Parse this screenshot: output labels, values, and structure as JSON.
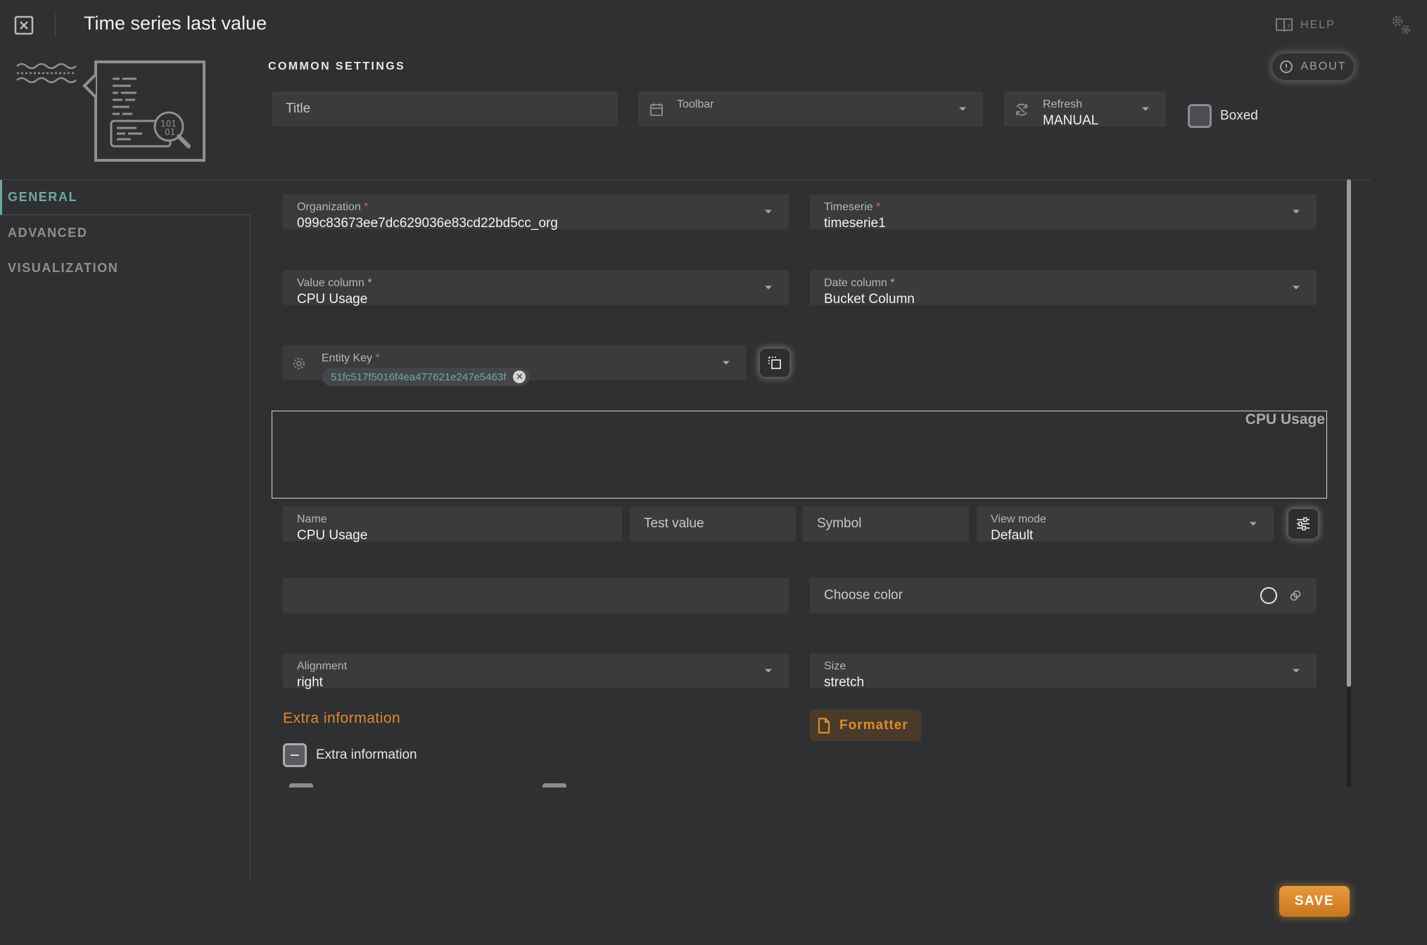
{
  "header": {
    "title": "Time series last value",
    "help_label": "HELP"
  },
  "common_settings": {
    "heading": "COMMON SETTINGS",
    "about_label": "ABOUT",
    "title_placeholder": "Title",
    "toolbar_label": "Toolbar",
    "toolbar_value": "",
    "refresh_label": "Refresh",
    "refresh_value": "MANUAL",
    "boxed_label": "Boxed",
    "boxed_checked": false
  },
  "nav": {
    "items": [
      {
        "label": "GENERAL",
        "active": true
      },
      {
        "label": "ADVANCED",
        "active": false
      },
      {
        "label": "VISUALIZATION",
        "active": false
      }
    ]
  },
  "general": {
    "organization": {
      "label": "Organization",
      "required_mark": "*",
      "value": "099c83673ee7dc629036e83cd22bd5cc_org"
    },
    "timeserie": {
      "label": "Timeserie",
      "required_mark": "*",
      "value": "timeserie1"
    },
    "value_column": {
      "label": "Value column *",
      "value": "CPU Usage"
    },
    "date_column": {
      "label": "Date column *",
      "value": "Bucket Column"
    },
    "entity_key": {
      "label": "Entity Key",
      "required_mark": "*",
      "chip": "51fc517f5016f4ea477621e247e5463f"
    },
    "preview_title": "CPU Usage",
    "series": {
      "name_label": "Name",
      "name_value": "CPU Usage",
      "test_value_placeholder": "Test value",
      "symbol_placeholder": "Symbol",
      "view_mode_label": "View mode",
      "view_mode_value": "Default"
    },
    "choose_color": "Choose color",
    "alignment": {
      "label": "Alignment",
      "value": "right"
    },
    "size": {
      "label": "Size",
      "value": "stretch"
    },
    "extra_heading": "Extra information",
    "formatter_label": "Formatter",
    "extra_checkbox_label": "Extra information"
  },
  "footer": {
    "save_label": "SAVE"
  },
  "colors": {
    "accent_teal": "#6fa8a3",
    "accent_orange": "#e08a2a",
    "background": "#2f3032",
    "field": "#3a3b3d"
  }
}
